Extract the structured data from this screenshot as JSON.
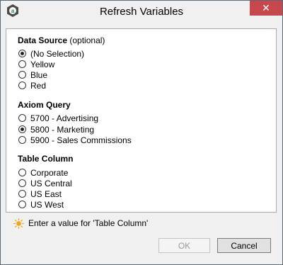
{
  "window": {
    "title": "Refresh Variables",
    "close_label": "✕"
  },
  "sections": {
    "data_source": {
      "title": "Data Source",
      "subtitle": "(optional)",
      "options": [
        "(No Selection)",
        "Yellow",
        "Blue",
        "Red"
      ],
      "selected_index": 0
    },
    "axiom_query": {
      "title": "Axiom Query",
      "options": [
        "5700 - Advertising",
        "5800 - Marketing",
        "5900 - Sales Commissions"
      ],
      "selected_index": 1
    },
    "table_column": {
      "title": "Table Column",
      "options": [
        "Corporate",
        "US Central",
        "US East",
        "US West"
      ],
      "selected_index": null
    }
  },
  "hint": {
    "icon": "sun-icon",
    "text": "Enter a value for 'Table Column'"
  },
  "buttons": {
    "ok_label": "OK",
    "cancel_label": "Cancel",
    "ok_enabled": false
  },
  "colors": {
    "close_button": "#c7484c",
    "hint_icon": "#f2a31a"
  }
}
